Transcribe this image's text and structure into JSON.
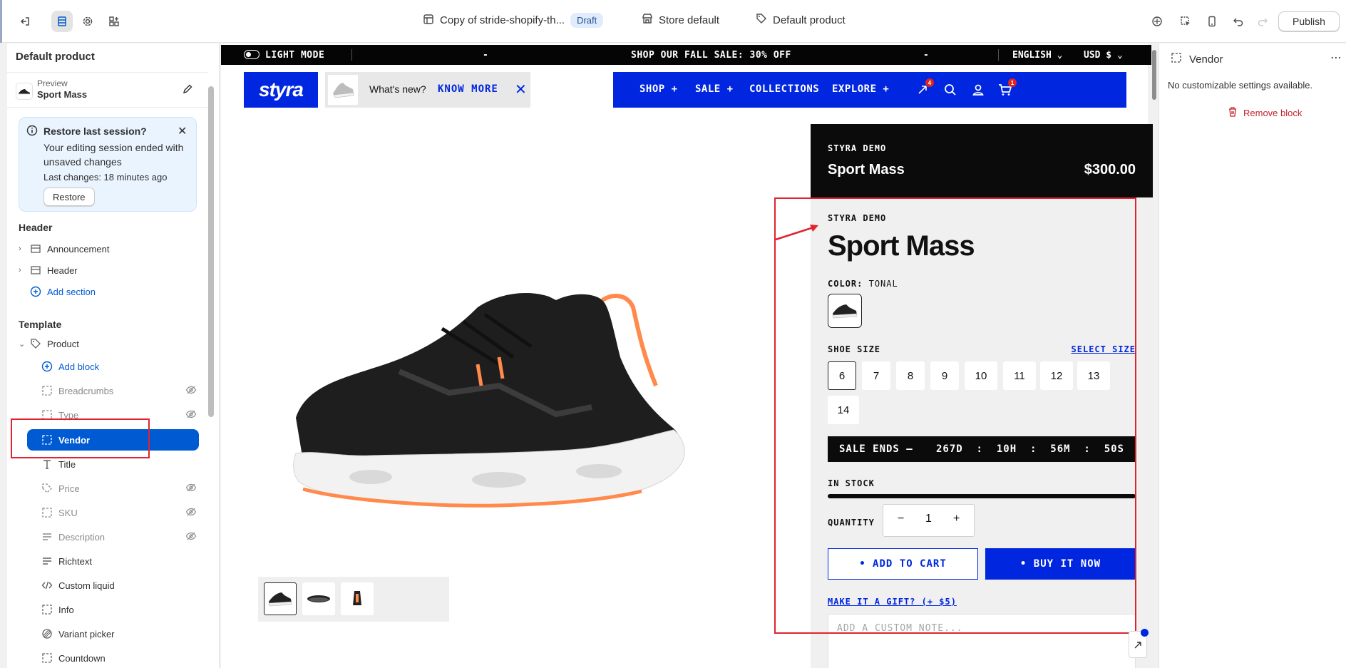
{
  "toolbar": {
    "theme_name": "Copy of stride-shopify-th...",
    "status_badge": "Draft",
    "store": "Store default",
    "template": "Default product",
    "publish_label": "Publish"
  },
  "sidebar": {
    "title": "Default product",
    "preview_label": "Preview",
    "preview_value": "Sport Mass",
    "restore": {
      "title": "Restore last session?",
      "body": "Your editing session ended with unsaved changes",
      "last": "Last changes: 18 minutes ago",
      "button": "Restore"
    },
    "header_section": "Header",
    "header_items": [
      {
        "label": "Announcement"
      },
      {
        "label": "Header"
      }
    ],
    "add_section": "Add section",
    "template_section": "Template",
    "product_label": "Product",
    "add_block": "Add block",
    "blocks": [
      {
        "label": "Breadcrumbs",
        "hidden": true
      },
      {
        "label": "Type",
        "hidden": true
      },
      {
        "label": "Vendor",
        "hidden": false,
        "selected": true
      },
      {
        "label": "Title",
        "hidden": false
      },
      {
        "label": "Price",
        "hidden": true
      },
      {
        "label": "SKU",
        "hidden": true
      },
      {
        "label": "Description",
        "hidden": true
      },
      {
        "label": "Richtext",
        "hidden": false
      },
      {
        "label": "Custom liquid",
        "hidden": false
      },
      {
        "label": "Info",
        "hidden": false
      },
      {
        "label": "Variant picker",
        "hidden": false
      },
      {
        "label": "Countdown",
        "hidden": false
      }
    ]
  },
  "store": {
    "light_mode": "LIGHT MODE",
    "announcement_dash": "-",
    "announcement": "SHOP OUR FALL SALE: 30% OFF",
    "language": "ENGLISH",
    "currency": "USD $",
    "logo": "styra",
    "whats_new": "What's new?",
    "know_more": "KNOW MORE",
    "close": "✕",
    "nav": [
      "SHOP +",
      "SALE +",
      "COLLECTIONS",
      "EXPLORE +"
    ],
    "compare_count": "4",
    "cart_count": "1",
    "card": {
      "vendor": "STYRA DEMO",
      "name": "Sport Mass",
      "price": "$300.00"
    },
    "product": {
      "vendor": "STYRA DEMO",
      "title": "Sport Mass",
      "color_label": "COLOR:",
      "color_value": "TONAL",
      "size_label": "SHOE SIZE",
      "size_link": "SELECT SIZE",
      "sizes": [
        "6",
        "7",
        "8",
        "9",
        "10",
        "11",
        "12",
        "13",
        "14"
      ],
      "sale_label": "SALE ENDS —",
      "countdown": "267D  :  10H  :  56M  :  50S",
      "stock": "IN STOCK",
      "qty_label": "QUANTITY",
      "qty_value": "1",
      "qty_minus": "−",
      "qty_plus": "+",
      "add_to_cart": "• ADD TO CART",
      "buy_now": "• BUY IT NOW",
      "gift": "MAKE IT A GIFT? (+ $5)",
      "note_placeholder": "ADD A CUSTOM NOTE..."
    }
  },
  "right_panel": {
    "title": "Vendor",
    "message": "No customizable settings available.",
    "remove": "Remove block"
  },
  "colors": {
    "accent": "#005bd3",
    "brand": "#0026e0",
    "annotation": "#e0232e"
  }
}
